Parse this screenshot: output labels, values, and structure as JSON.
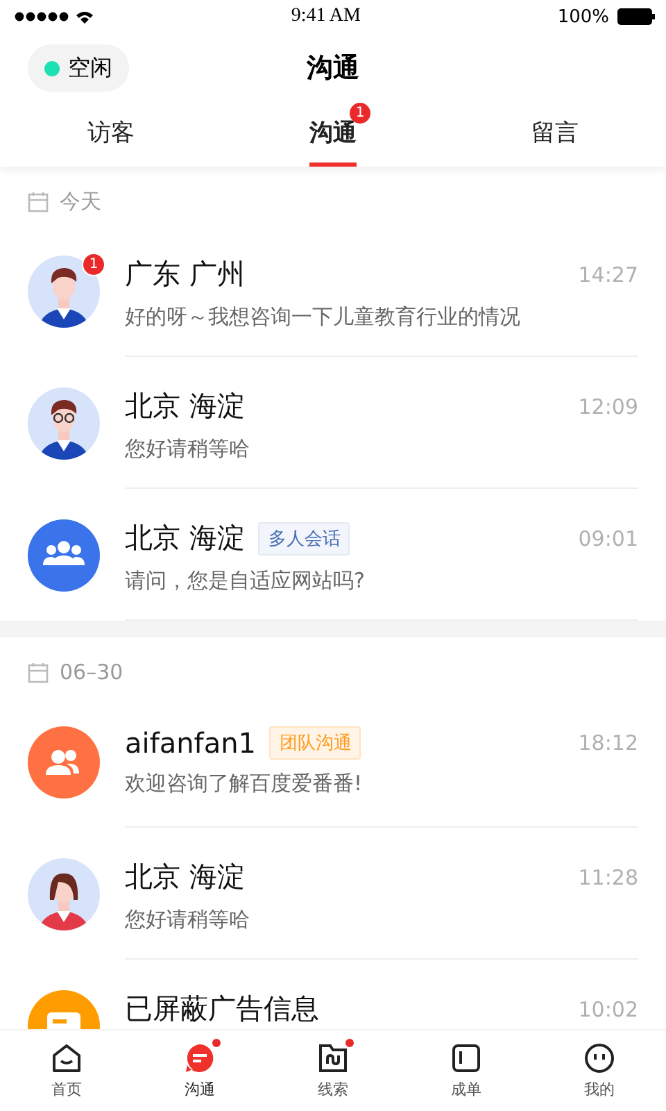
{
  "status_bar": {
    "time": "9:41 AM",
    "battery": "100%"
  },
  "header": {
    "status": {
      "label": "空闲",
      "color": "#1de0b4"
    },
    "title": "沟通"
  },
  "tabs": [
    {
      "label": "访客",
      "selected": false
    },
    {
      "label": "沟通",
      "selected": true,
      "badge": "1"
    },
    {
      "label": "留言",
      "selected": false
    }
  ],
  "sections": [
    {
      "date": "今天",
      "conversations": [
        {
          "kind": "man",
          "name": "广东 广州",
          "time": "14:27",
          "message": "好的呀～我想咨询一下儿童教育行业的情况",
          "badge": "1"
        },
        {
          "kind": "glasses",
          "name": "北京 海淀",
          "time": "12:09",
          "message": "您好请稍等哈"
        },
        {
          "kind": "group",
          "name": "北京 海淀",
          "tag": {
            "label": "多人会话",
            "kind": "multi"
          },
          "time": "09:01",
          "message": "请问，您是自适应网站吗?"
        }
      ]
    },
    {
      "date": "06–30",
      "conversations": [
        {
          "kind": "team",
          "name": "aifanfan1",
          "tag": {
            "label": "团队沟通",
            "kind": "team"
          },
          "time": "18:12",
          "message": "欢迎咨询了解百度爱番番!"
        },
        {
          "kind": "woman",
          "name": "北京 海淀",
          "time": "11:28",
          "message": "您好请稍等哈"
        },
        {
          "kind": "blocked",
          "name": "已屏蔽广告信息",
          "time": "10:02"
        }
      ]
    }
  ],
  "nav": [
    {
      "kind": "home",
      "label": "首页",
      "selected": false,
      "dot": false
    },
    {
      "kind": "chat",
      "label": "沟通",
      "selected": true,
      "dot": true
    },
    {
      "kind": "leads",
      "label": "线索",
      "selected": false,
      "dot": true
    },
    {
      "kind": "orders",
      "label": "成单",
      "selected": false,
      "dot": false
    },
    {
      "kind": "me",
      "label": "我的",
      "selected": false,
      "dot": false
    }
  ]
}
